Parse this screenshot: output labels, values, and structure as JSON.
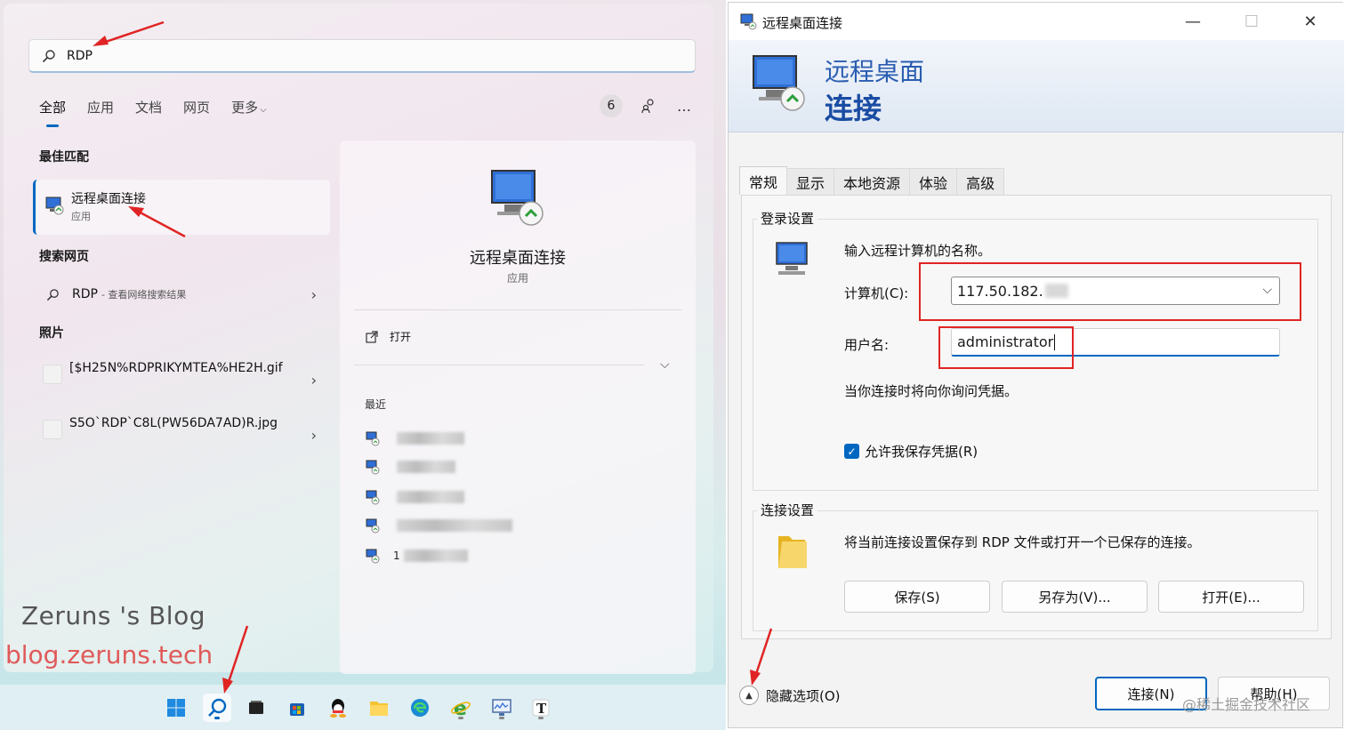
{
  "search": {
    "query": "RDP",
    "tabs": [
      "全部",
      "应用",
      "文档",
      "网页",
      "更多"
    ],
    "count_badge": "6",
    "more_icon": "…"
  },
  "best_match": {
    "heading": "最佳匹配",
    "title": "远程桌面连接",
    "subtitle": "应用"
  },
  "web_search": {
    "heading": "搜索网页",
    "query": "RDP",
    "suffix": "- 查看网络搜索结果"
  },
  "photos": {
    "heading": "照片",
    "items": [
      {
        "name": "[$H25N%RDPRIKYMTEA%HE2H.gif"
      },
      {
        "name": "S5O`RDP`C8L(PW56DA7AD)R.jpg"
      }
    ]
  },
  "preview": {
    "title": "远程桌面连接",
    "subtitle": "应用",
    "open_label": "打开",
    "recent_label": "最近",
    "recent_items": [
      {
        "prefix": ""
      },
      {
        "prefix": ""
      },
      {
        "prefix": ""
      },
      {
        "prefix": ""
      },
      {
        "prefix": "1"
      }
    ]
  },
  "watermark": {
    "name": "Zeruns 's Blog",
    "url": "blog.zeruns.tech"
  },
  "taskbar": {
    "icons": [
      "windows-start-icon",
      "search-icon",
      "task-view-icon",
      "store-icon",
      "qq-icon",
      "file-explorer-icon",
      "edge-icon",
      "ie-icon",
      "monitor-icon",
      "typora-icon"
    ]
  },
  "rdp": {
    "window_title": "远程桌面连接",
    "banner_line1": "远程桌面",
    "banner_line2": "连接",
    "tabs": [
      "常规",
      "显示",
      "本地资源",
      "体验",
      "高级"
    ],
    "login_group": "登录设置",
    "prompt": "输入远程计算机的名称。",
    "computer_label": "计算机(C):",
    "computer_value": "117.50.182.",
    "username_label": "用户名:",
    "username_value": "administrator",
    "credential_note": "当你连接时将向你询问凭据。",
    "allow_save_label": "允许我保存凭据(R)",
    "allow_save_checked": true,
    "conn_group": "连接设置",
    "conn_desc": "将当前连接设置保存到 RDP 文件或打开一个已保存的连接。",
    "save_btn": "保存(S)",
    "saveas_btn": "另存为(V)...",
    "open_btn": "打开(E)...",
    "hide_options": "隐藏选项(O)",
    "connect_btn": "连接(N)",
    "help_btn": "帮助(H)",
    "watermark": "@稀土掘金技术社区"
  },
  "colors": {
    "accent": "#0067c0",
    "annotation_red": "#e02424",
    "watermark_pink": "#e05a5a"
  }
}
